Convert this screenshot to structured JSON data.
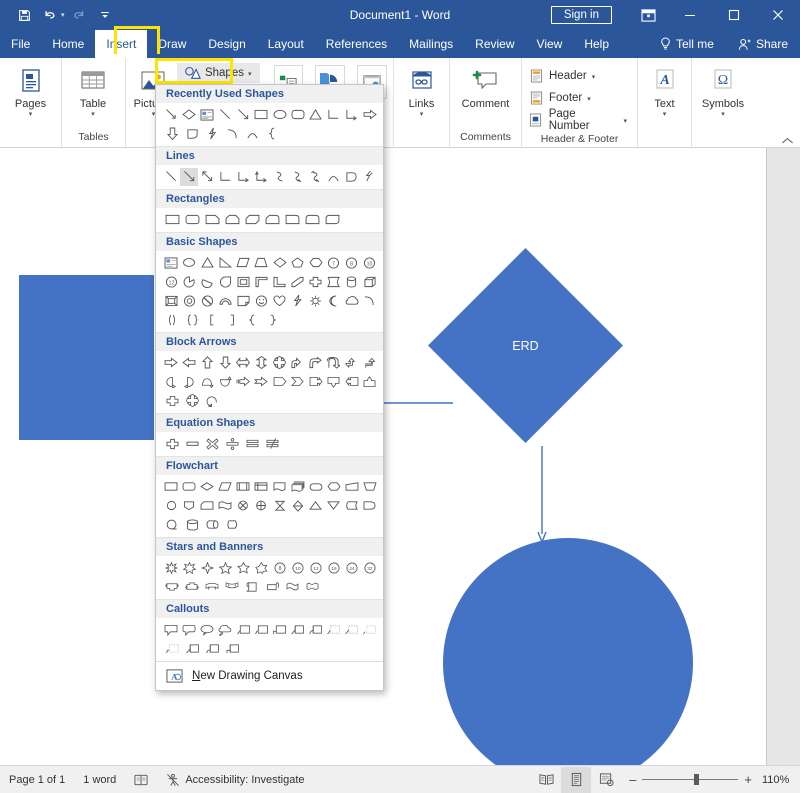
{
  "window": {
    "title": "Document1  -  Word",
    "signin_label": "Sign in",
    "quick_access": [
      {
        "name": "save-icon",
        "label": "Save"
      },
      {
        "name": "undo-icon",
        "label": "Undo"
      },
      {
        "name": "redo-icon",
        "label": "Redo"
      },
      {
        "name": "customize-quick-access-icon",
        "label": "Customize Quick Access Toolbar"
      }
    ],
    "controls": [
      {
        "name": "ribbon-display-options-icon",
        "label": "Ribbon Display Options"
      },
      {
        "name": "minimize-icon",
        "label": "Minimize",
        "glyph": "–"
      },
      {
        "name": "maximize-icon",
        "label": "Maximize",
        "glyph": "□"
      },
      {
        "name": "close-icon",
        "label": "Close",
        "glyph": "✕"
      }
    ]
  },
  "tabs": [
    {
      "label": "File",
      "active": false
    },
    {
      "label": "Home",
      "active": false
    },
    {
      "label": "Insert",
      "active": true
    },
    {
      "label": "Draw",
      "active": false
    },
    {
      "label": "Design",
      "active": false
    },
    {
      "label": "Layout",
      "active": false
    },
    {
      "label": "References",
      "active": false
    },
    {
      "label": "Mailings",
      "active": false
    },
    {
      "label": "Review",
      "active": false
    },
    {
      "label": "View",
      "active": false
    },
    {
      "label": "Help",
      "active": false
    }
  ],
  "tab_right": {
    "tell_me": "Tell me",
    "share": "Share"
  },
  "ribbon": {
    "groups": [
      {
        "name": "pages",
        "label": "",
        "buttons": [
          {
            "label": "Pages",
            "icon": "pages-icon"
          }
        ]
      },
      {
        "name": "tables",
        "label": "Tables",
        "buttons": [
          {
            "label": "Table",
            "icon": "table-icon"
          }
        ]
      },
      {
        "name": "illustrations",
        "label": "",
        "buttons": [
          {
            "label": "Pictures",
            "icon": "pictures-icon"
          }
        ]
      },
      {
        "name": "links",
        "label": "",
        "buttons": [
          {
            "label": "Links",
            "icon": "links-icon"
          }
        ]
      },
      {
        "name": "comments",
        "label": "Comments",
        "buttons": [
          {
            "label": "Comment",
            "icon": "comment-icon"
          }
        ]
      },
      {
        "name": "header-footer",
        "label": "Header & Footer",
        "buttons": []
      },
      {
        "name": "text",
        "label": "",
        "buttons": [
          {
            "label": "Text",
            "icon": "text-icon"
          }
        ]
      },
      {
        "name": "symbols",
        "label": "",
        "buttons": [
          {
            "label": "Symbols",
            "icon": "omega-icon"
          }
        ]
      }
    ],
    "shapes_button": "Shapes",
    "header_footer_items": [
      {
        "label": "Header",
        "icon": "header-icon"
      },
      {
        "label": "Footer",
        "icon": "footer-icon"
      },
      {
        "label": "Page Number",
        "icon": "page-number-icon"
      }
    ],
    "icon_buttons": [
      {
        "name": "smartart-icon",
        "label": "SmartArt"
      },
      {
        "name": "chart-icon",
        "label": "Chart"
      },
      {
        "name": "screenshot-icon",
        "label": "Screenshot"
      }
    ],
    "collapse_label": "Collapse the Ribbon"
  },
  "shapes_menu": {
    "sections": [
      {
        "title": "Recently Used Shapes",
        "rows": [
          [
            "line-arrow",
            "diamond",
            "text-box",
            "line",
            "line-arrow-2",
            "rectangle",
            "oval",
            "rounded-rectangle",
            "triangle",
            "elbow-connector",
            "elbow-arrow-connector",
            "right-arrow"
          ],
          [
            "down-arrow",
            "pentagon-arrow",
            "lightning-bolt",
            "arc",
            "arc-2",
            "left-brace"
          ]
        ]
      },
      {
        "title": "Lines",
        "rows": [
          [
            "line",
            "line-arrow",
            "line-double-arrow",
            "elbow-connector",
            "elbow-arrow",
            "elbow-double-arrow",
            "curved-connector",
            "curved-arrow",
            "curved-double-arrow",
            "arc",
            "freeform",
            "scribble"
          ]
        ],
        "selected": {
          "row": 0,
          "index": 1
        }
      },
      {
        "title": "Rectangles",
        "rows": [
          [
            "rectangle",
            "rounded-rectangle",
            "snip-single-corner",
            "snip-same-side-corner",
            "snip-diagonal-corner",
            "snip-and-round-corner",
            "round-single-corner",
            "round-same-side-corner",
            "round-diagonal-corner"
          ]
        ]
      },
      {
        "title": "Basic Shapes",
        "rows": [
          [
            "text-box",
            "oval",
            "triangle",
            "right-triangle",
            "parallelogram",
            "trapezoid",
            "diamond",
            "pentagon",
            "hexagon",
            "heptagon",
            "octagon",
            "decagon"
          ],
          [
            "dodecagon",
            "pie",
            "chord",
            "teardrop",
            "frame",
            "half-frame",
            "l-shape",
            "diagonal-stripe",
            "cross",
            "plaque",
            "can",
            "cube"
          ],
          [
            "bevel",
            "donut",
            "no-symbol",
            "block-arc",
            "folded-corner",
            "smiley-face",
            "heart",
            "lightning-bolt",
            "sun",
            "moon",
            "cloud",
            "arc"
          ],
          [
            "round-bracket",
            "round-double-bracket",
            "square-bracket",
            "square-bracket-right",
            "curly-brace",
            "curly-brace-right"
          ]
        ]
      },
      {
        "title": "Block Arrows",
        "rows": [
          [
            "right-arrow",
            "left-arrow",
            "up-arrow",
            "down-arrow",
            "left-right-arrow",
            "up-down-arrow",
            "four-way-arrow",
            "bent-arrow-t",
            "bent-arrow",
            "u-turn-arrow",
            "left-up-arrow",
            "bent-up-arrow"
          ],
          [
            "curved-right-arrow",
            "curved-left-arrow",
            "curved-up-arrow",
            "curved-down-arrow",
            "striped-right-arrow",
            "notched-right-arrow",
            "pentagon-arrow",
            "chevron",
            "right-arrow-callout",
            "down-arrow-callout",
            "left-arrow-callout",
            "up-arrow-callout"
          ],
          [
            "cross-arrow",
            "quad-arrow-callout",
            "circular-arrow"
          ]
        ]
      },
      {
        "title": "Equation Shapes",
        "rows": [
          [
            "plus-sign",
            "minus-sign",
            "multiply-sign",
            "division-sign",
            "equal-sign",
            "not-equal-sign"
          ]
        ]
      },
      {
        "title": "Flowchart",
        "rows": [
          [
            "process",
            "alternate-process",
            "decision",
            "data",
            "predefined-process",
            "internal-storage",
            "document",
            "multidocument",
            "terminator",
            "preparation",
            "manual-input",
            "manual-operation"
          ],
          [
            "connector",
            "off-page-connector",
            "card",
            "punched-tape",
            "summing-junction",
            "or",
            "collate",
            "sort",
            "extract",
            "merge",
            "stored-data",
            "delay"
          ],
          [
            "sequential-access",
            "magnetic-disk",
            "direct-access-storage",
            "display"
          ]
        ]
      },
      {
        "title": "Stars and Banners",
        "rows": [
          [
            "star-4",
            "star-5",
            "star-4-point",
            "star-5-point",
            "star-6-point",
            "star-7-point",
            "star-8-point",
            "star-10-point",
            "star-12-point",
            "star-16-point",
            "star-24-point",
            "star-32-point"
          ],
          [
            "up-ribbon",
            "down-ribbon",
            "curved-up-ribbon",
            "curved-down-ribbon",
            "vertical-scroll",
            "horizontal-scroll",
            "wave",
            "double-wave"
          ]
        ]
      },
      {
        "title": "Callouts",
        "rows": [
          [
            "rectangular-callout",
            "rounded-rectangular-callout",
            "oval-callout",
            "cloud-callout",
            "line-callout-1",
            "line-callout-2",
            "line-callout-3",
            "line-callout-accent-1",
            "line-callout-accent-2",
            "line-callout-border-1",
            "line-callout-border-2",
            "line-callout-no-border-1"
          ],
          [
            "line-callout-no-border-2",
            "line-callout-accent-bar-1",
            "line-callout-accent-bar-2",
            "line-callout-accent-bar-3"
          ]
        ]
      }
    ],
    "new_drawing_canvas": "New Drawing Canvas",
    "new_drawing_canvas_accel": "N"
  },
  "document": {
    "shapes": [
      {
        "name": "rectangle-shape",
        "type": "rectangle",
        "label": "",
        "color": "#4472C4"
      },
      {
        "name": "diamond-shape",
        "type": "diamond",
        "label": "ERD",
        "color": "#4472C4",
        "text_color": "#FFFFFF"
      },
      {
        "name": "circle-shape",
        "type": "circle",
        "label": "",
        "color": "#4472C4"
      },
      {
        "name": "connector-line",
        "type": "line",
        "label": "",
        "color": "#4472C4"
      },
      {
        "name": "down-arrow-connector",
        "type": "arrow",
        "label": "",
        "color": "#4472C4"
      }
    ]
  },
  "status_bar": {
    "page": "Page 1 of 1",
    "words": "1 word",
    "proofing_icon": "proofing-icon",
    "accessibility": "Accessibility: Investigate",
    "views": [
      {
        "name": "read-mode-view",
        "label": "Read Mode",
        "active": false
      },
      {
        "name": "print-layout-view",
        "label": "Print Layout",
        "active": true
      },
      {
        "name": "web-layout-view",
        "label": "Web Layout",
        "active": false
      }
    ],
    "zoom_out": "–",
    "zoom_in": "+",
    "zoom_level": "110%"
  },
  "colors": {
    "title_bar": "#2b579a",
    "accent_shape": "#4472C4",
    "highlight": "#ffe400",
    "section_header_text": "#2b579a"
  }
}
